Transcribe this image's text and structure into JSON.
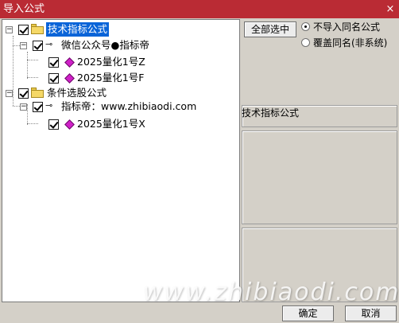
{
  "window": {
    "title": "导入公式",
    "close_label": "×"
  },
  "tree": {
    "items": [
      {
        "label": "技术指标公式",
        "checked": true,
        "expanded": true,
        "selected": true
      },
      {
        "label": "微信公众号●指标帝",
        "checked": true,
        "expanded": true
      },
      {
        "label": "2025量化1号Z",
        "checked": true
      },
      {
        "label": "2025量化1号F",
        "checked": true
      },
      {
        "label": "条件选股公式",
        "checked": true,
        "expanded": true
      },
      {
        "label": "指标帝：www.zhibiaodi.com",
        "checked": true,
        "expanded": true
      },
      {
        "label": "2025量化1号X",
        "checked": true
      }
    ],
    "expander_symbol": "−"
  },
  "options": {
    "select_all_label": "全部选中",
    "radio_options": [
      {
        "label": "不导入同名公式",
        "selected": true
      },
      {
        "label": "覆盖同名(非系统)",
        "selected": false
      }
    ]
  },
  "side_panel": {
    "title": "技术指标公式"
  },
  "footer": {
    "ok_label": "确定",
    "cancel_label": "取消"
  },
  "watermark": "www.zhibiaodi.com",
  "colors": {
    "titlebar": "#ba2b34",
    "selection": "#0a64d8",
    "formula_gem": "#d020c8",
    "folder": "#f5d867"
  }
}
